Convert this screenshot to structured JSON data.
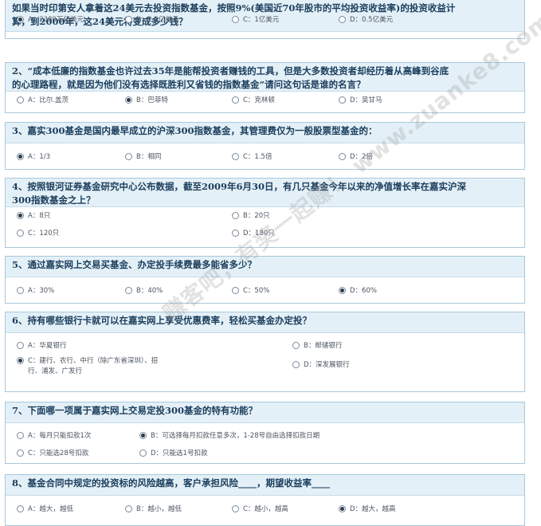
{
  "watermark": "赚客吧，有奖一起赚！ www.zuanke8.com",
  "questions": [
    {
      "title": [
        "如果当时印第安人拿着这24美元去投资指数基金，按照9%(美国近70年股市的平均投资收益率)的投资收益计",
        "算，到2000年，这24美元将变成多少钱？"
      ],
      "options": [
        "A：2380万亿美元",
        "B：2.5亿美元",
        "C：1亿美元",
        "D：0.5亿美元"
      ],
      "selected": 0
    },
    {
      "title": [
        "2、“成本低廉的指数基金也许过去35年是能帮投资者赚钱的工具，但是大多数投资者却经历着从高峰到谷底",
        "的心理路程，就是因为他们没有选择既胜利又省钱的指数基金”请问这句话是谁的名言？"
      ],
      "options": [
        "A：比尔.盖茨",
        "B：巴菲特",
        "C：克林顿",
        "D：吴甘马"
      ],
      "selected": 1
    },
    {
      "title": [
        "3、嘉实300基金是国内最早成立的沪深300指数基金，其管理费仅为一般股票型基金的："
      ],
      "options": [
        "A：1/3",
        "B：相同",
        "C：1.5倍",
        "D：2倍"
      ],
      "selected": 0
    },
    {
      "title": [
        "4、按照银河证券基金研究中心公布数据，截至2009年6月30日，有几只基金今年以来的净值增长率在嘉实沪深",
        "300指数基金之上？"
      ],
      "options": [
        "A：8只",
        "B：20只",
        "C：120只",
        "D：180只"
      ],
      "selected": 0
    },
    {
      "title": [
        "5、通过嘉实网上交易买基金、办定投手续费最多能省多少？"
      ],
      "options": [
        "A：30%",
        "B：40%",
        "C：50%",
        "D：60%"
      ],
      "selected": 3
    },
    {
      "title": [
        "6、持有哪些银行卡就可以在嘉实网上享受优惠费率，轻松买基金办定投？"
      ],
      "options": [
        "A：华夏银行",
        "B：邮储银行",
        "C：建行、农行、中行（除广东省深圳）、招\n行、浦发、广发行",
        "D：深发展银行"
      ],
      "selected": 2
    },
    {
      "title": [
        "7、下面哪一项属于嘉实网上交易定投300基金的特有功能？"
      ],
      "options": [
        "A：每月只能扣款1次",
        "B：可选择每月扣款任意多次，1-28号自由选择扣款日期",
        "C：只能选28号扣款",
        "D：只能选1号扣款"
      ],
      "selected": 1
    },
    {
      "title": [
        "8、基金合同中规定的投资标的风险越高，客户承担风险____，期望收益率____"
      ],
      "options": [
        "A：越大，越低",
        "B：越小，越低",
        "C：越小，越高",
        "D：越大，越高"
      ],
      "selected": 3
    }
  ]
}
